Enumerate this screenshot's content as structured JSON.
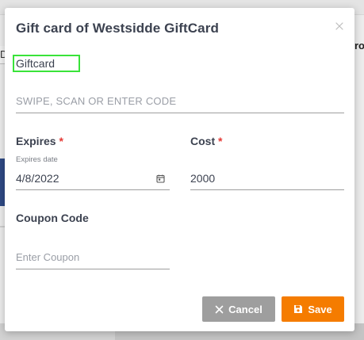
{
  "background": {
    "left_partial_text": "Dg",
    "right_partial_text": "ro"
  },
  "modal": {
    "title": "Gift card of Westsidde GiftCard",
    "section_label": "Giftcard",
    "code_placeholder": "SWIPE, SCAN OR ENTER CODE",
    "expires": {
      "label": "Expires",
      "required_mark": "*",
      "hint": "Expires date",
      "value": "4/8/2022"
    },
    "cost": {
      "label": "Cost",
      "required_mark": "*",
      "value": "2000"
    },
    "coupon": {
      "label": "Coupon Code",
      "placeholder": "Enter Coupon"
    },
    "buttons": {
      "cancel_label": "Cancel",
      "save_label": "Save"
    }
  },
  "colors": {
    "cancel_bg": "#9e9e9e",
    "save_bg": "#f57c00",
    "required": "#e53935",
    "highlight_box": "#39e339"
  },
  "icons": {
    "close": "close-icon",
    "calendar": "calendar-icon",
    "cancel": "x-icon",
    "save": "floppy-disk-icon"
  }
}
